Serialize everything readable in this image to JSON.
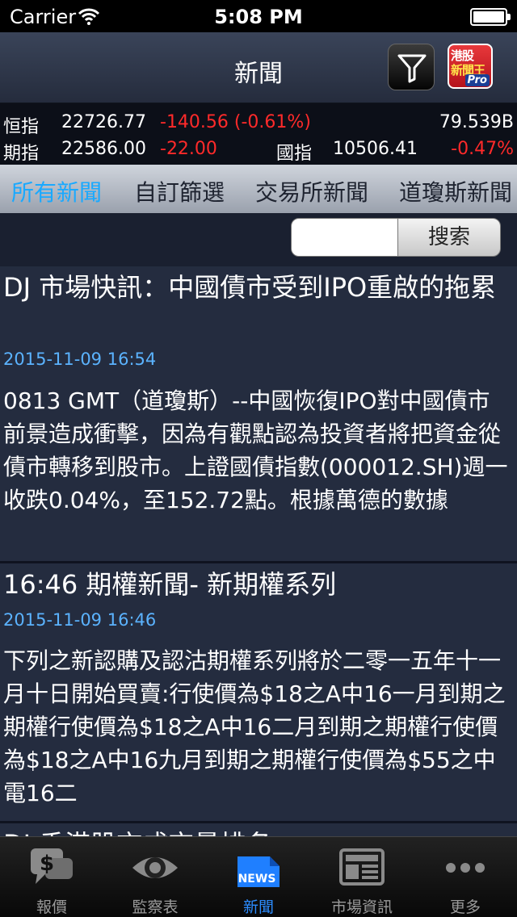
{
  "status": {
    "carrier": "Carrier",
    "time": "5:08 PM"
  },
  "nav": {
    "title": "新聞",
    "logo_line1": "港股",
    "logo_line2": "新聞王",
    "logo_badge": "Pro"
  },
  "ticker": {
    "hsi_label": "恒指",
    "hsi_value": "22726.77",
    "hsi_change": "-140.56 (-0.61%)",
    "turnover": "79.539B",
    "fut_label": "期指",
    "fut_value": "22586.00",
    "fut_change": "-22.00",
    "hscei_label": "國指",
    "hscei_value": "10506.41",
    "hscei_change": "-0.47%"
  },
  "tabs": [
    "所有新聞",
    "自訂篩選",
    "交易所新聞",
    "道瓊斯新聞"
  ],
  "search": {
    "value": "",
    "button": "搜索"
  },
  "news": [
    {
      "title": "DJ 市場快訊：中國債市受到IPO重啟的拖累",
      "date": "2015-11-09 16:54",
      "body": "0813 GMT（道瓊斯）--中國恢復IPO對中國債市前景造成衝擊，因為有觀點認為投資者將把資金從債市轉移到股市。上證國債指數(000012.SH)週一收跌0.04%，至152.72點。根據萬德的數據"
    },
    {
      "title": "16:46 期權新聞- 新期權系列",
      "date": "2015-11-09 16:46",
      "body": "下列之新認購及認沽期權系列將於二零一五年十一月十日開始買賣:行使價為$18之A中16一月到期之期權行使價為$18之A中16二月到期之期權行使價為$18之A中16九月到期之期權行使價為$55之中電16二"
    },
    {
      "title": "DJ 香港股市成交量排名",
      "date": "",
      "body": ""
    }
  ],
  "tabbar": [
    "報價",
    "監察表",
    "新聞",
    "市場資訊",
    "更多"
  ],
  "icons": {
    "news_badge": "NEWS"
  }
}
